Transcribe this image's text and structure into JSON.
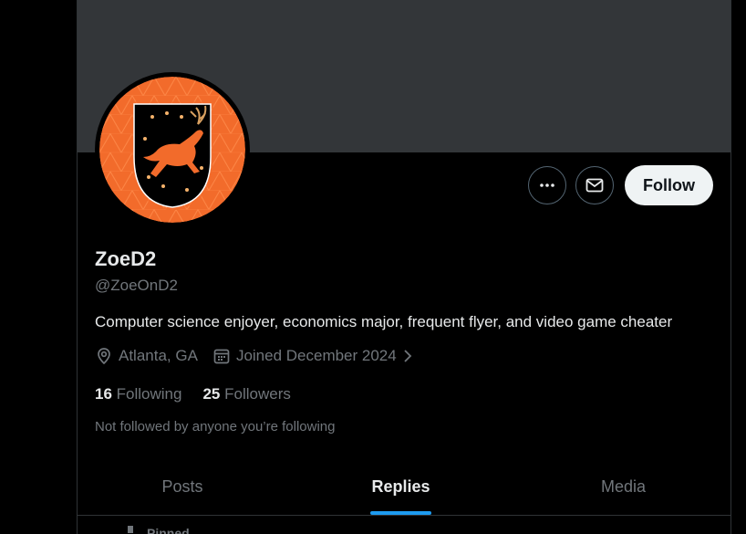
{
  "profile": {
    "name": "ZoeD2",
    "handle": "@ZoeOnD2",
    "bio": "Computer science enjoyer, economics major, frequent flyer, and video game cheater",
    "location": "Atlanta, GA",
    "joined": "Joined December 2024",
    "following_count": "16",
    "following_label": "Following",
    "followers_count": "25",
    "followers_label": "Followers",
    "not_followed_text": "Not followed by anyone you’re following"
  },
  "actions": {
    "more_icon": "more-horizontal-icon",
    "message_icon": "envelope-icon",
    "follow_label": "Follow"
  },
  "tabs": [
    {
      "label": "Posts",
      "active": false
    },
    {
      "label": "Replies",
      "active": true
    },
    {
      "label": "Media",
      "active": false
    }
  ],
  "pinned": {
    "label": "Pinned"
  },
  "colors": {
    "accent": "#1d9bf0",
    "banner": "#333639",
    "avatar_orange": "#f26b2b",
    "muted_text": "#71767b"
  }
}
